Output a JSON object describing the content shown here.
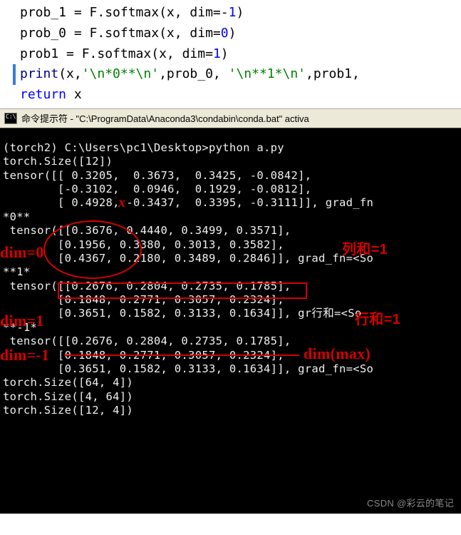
{
  "code": {
    "l1_a": "prob_1 = F.softmax(x, dim=-",
    "l1_num": "1",
    "l1_b": ")",
    "l2_a": "prob_0 = F.softmax(x, dim=",
    "l2_num": "0",
    "l2_b": ")",
    "l3_a": "prob1 = F.softmax(x, dim=",
    "l3_num": "1",
    "l3_b": ")",
    "l4_kw": "print",
    "l4_a": "(x,",
    "l4_s1": "'\\n*0**\\n'",
    "l4_b": ",prob_0, ",
    "l4_s2": "'\\n**1*\\n'",
    "l4_c": ",prob1,",
    "l5_kw": "return",
    "l5_a": " x"
  },
  "titlebar": {
    "text": "命令提示符 - \"C:\\ProgramData\\Anaconda3\\condabin\\conda.bat\" activa"
  },
  "terminal": {
    "lines": [
      "(torch2) C:\\Users\\pc1\\Desktop>python a.py",
      "torch.Size([12])",
      "tensor([[ 0.3205,  0.3673,  0.3425, -0.0842],",
      "        [-0.3102,  0.0946,  0.1929, -0.0812],",
      "        [ 0.4928, -0.3437,  0.3395, -0.3111]], grad_fn",
      "*0**",
      " tensor([[0.3676, 0.4440, 0.3499, 0.3571],",
      "        [0.1956, 0.3380, 0.3013, 0.3582],",
      "        [0.4367, 0.2180, 0.3489, 0.2846]], grad_fn=<So",
      "**1*",
      " tensor([[0.2676, 0.2804, 0.2735, 0.1785],",
      "        [0.1848, 0.2771, 0.3057, 0.2324],",
      "        [0.3651, 0.1582, 0.3133, 0.1634]], gr行和=<So",
      "**-1*",
      " tensor([[0.2676, 0.2804, 0.2735, 0.1785],",
      "        [0.1848, 0.2771, 0.3057, 0.2324],",
      "        [0.3651, 0.1582, 0.3133, 0.1634]], grad_fn=<So",
      "torch.Size([64, 4])",
      "torch.Size([4, 64])",
      "torch.Size([12, 4])"
    ]
  },
  "annotations": {
    "x_label": "x",
    "dim0": "dim=0",
    "col_sum": "列和=1",
    "dim1": "dim=1",
    "row_sum": "行和=1",
    "dim_neg1": "dim=-1",
    "dim_max": "dim(max)"
  },
  "watermark": "CSDN @彩云的笔记"
}
